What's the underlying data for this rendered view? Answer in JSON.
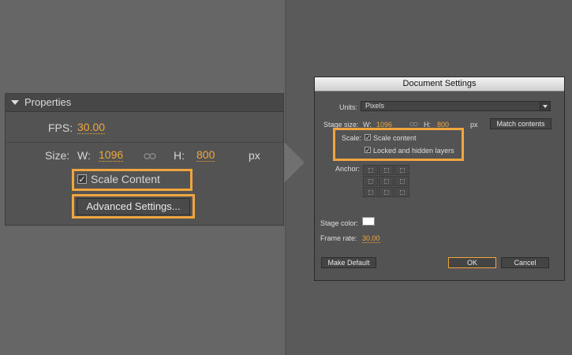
{
  "properties_panel": {
    "title": "Properties",
    "fps_label": "FPS:",
    "fps_value": "30.00",
    "size_label": "Size:",
    "w_label": "W:",
    "w_value": "1096",
    "h_label": "H:",
    "h_value": "800",
    "unit": "px",
    "scale_content_label": "Scale Content",
    "scale_content_checked": true,
    "advanced_button": "Advanced Settings..."
  },
  "dialog": {
    "title": "Document Settings",
    "units_label": "Units:",
    "units_value": "Pixels",
    "stage_size_label": "Stage size:",
    "w_label": "W:",
    "w_value": "1096",
    "h_label": "H:",
    "h_value": "800",
    "unit": "px",
    "match_contents_button": "Match contents",
    "scale_label": "Scale:",
    "scale_content_label": "Scale content",
    "locked_hidden_label": "Locked and hidden layers",
    "anchor_label": "Anchor:",
    "stage_color_label": "Stage color:",
    "stage_color": "#ffffff",
    "frame_rate_label": "Frame rate:",
    "frame_rate_value": "30.00",
    "make_default_button": "Make Default",
    "ok_button": "OK",
    "cancel_button": "Cancel"
  },
  "colors": {
    "highlight": "#f0a53f",
    "accent_value": "#f0a73a"
  }
}
